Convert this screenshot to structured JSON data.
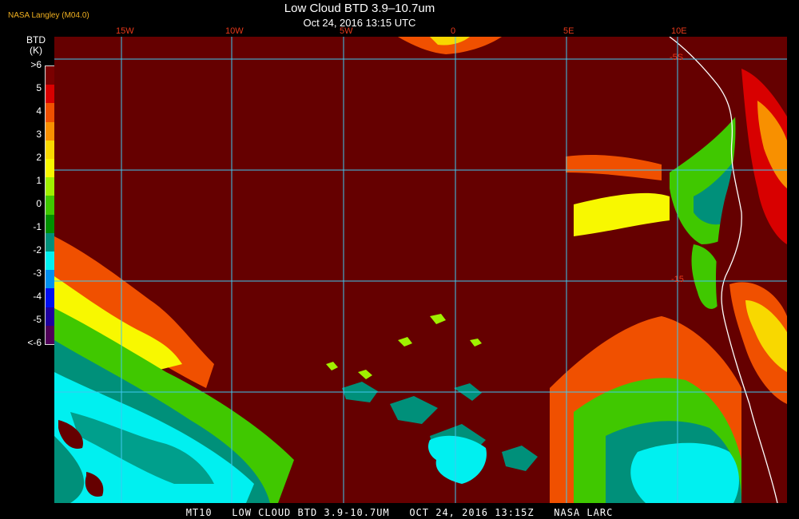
{
  "header": {
    "credit": "NASA Langley (M04.0)",
    "title": "Low Cloud BTD 3.9–10.7um",
    "subtitle": "Oct 24, 2016 13:15 UTC"
  },
  "legend": {
    "title_line1": "BTD",
    "title_line2": "(K)",
    "ticks": [
      ">6",
      "5",
      "4",
      "3",
      "2",
      "1",
      "0",
      "-1",
      "-2",
      "-3",
      "-4",
      "-5",
      "<-6"
    ],
    "colors": [
      "#7a0000",
      "#d80000",
      "#f05000",
      "#f89000",
      "#f8d800",
      "#f8f800",
      "#a0f000",
      "#40c800",
      "#009000",
      "#00907a",
      "#00f0f0",
      "#0090f0",
      "#0010f0",
      "#2000a0",
      "#500058"
    ]
  },
  "grid": {
    "longitude_labels": [
      "15W",
      "10W",
      "5W",
      "0",
      "5E",
      "10E"
    ],
    "latitude_labels": [
      "-5S",
      "-15"
    ],
    "line_color": "#40c8f0"
  },
  "footer": {
    "text": "MT10   LOW CLOUD BTD 3.9-10.7UM   OCT 24, 2016 13:15Z   NASA LARC"
  },
  "colors": {
    "background": "#650000",
    "coast": "#ffffff"
  }
}
